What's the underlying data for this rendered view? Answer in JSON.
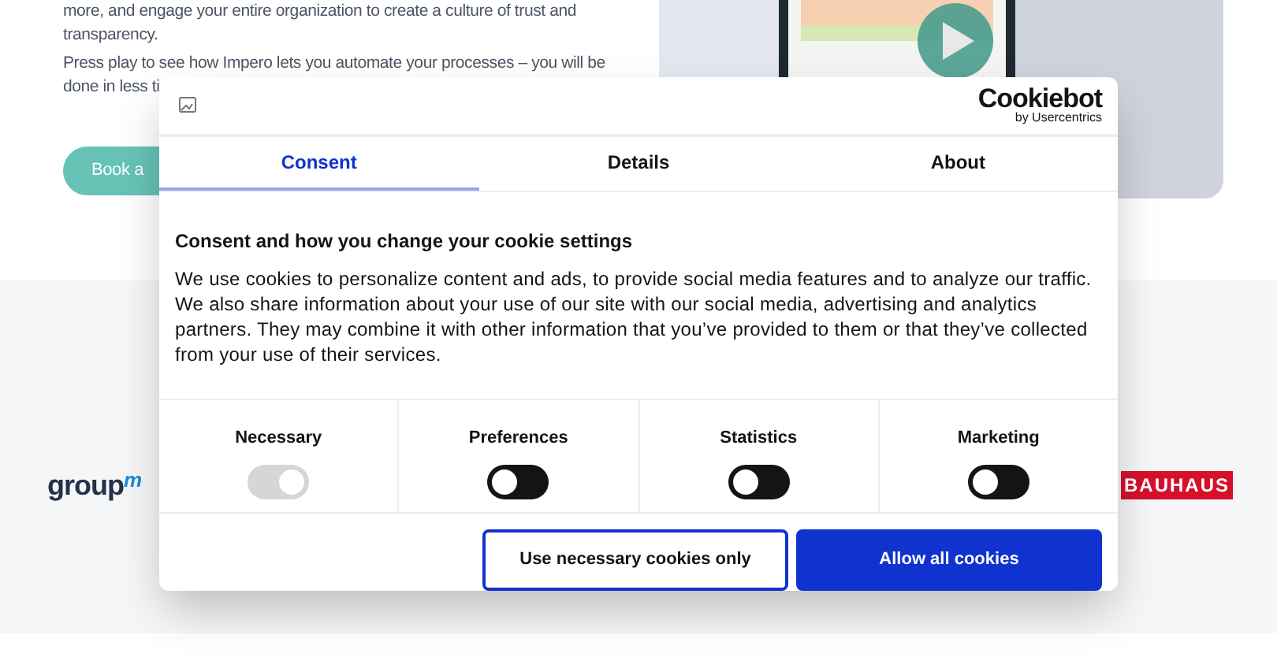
{
  "intro": {
    "paragraphs": [
      "more, and engage your entire organization to create a culture of trust and transparency.",
      "Press play to see how Impero lets you automate your processes – you will be",
      "done in less ti"
    ],
    "button": "Book a"
  },
  "logos": [
    {
      "text": "group",
      "mark": "m"
    },
    {
      "text": "BAUHAUS"
    }
  ],
  "dialog": {
    "brand": "Cookiebot",
    "brand_sub": "by Usercentrics",
    "tabs": [
      {
        "label": "Consent",
        "selected": true
      },
      {
        "label": "Details",
        "selected": false
      },
      {
        "label": "About",
        "selected": false
      }
    ],
    "heading": "Consent and how you change your cookie settings",
    "body": "We use cookies to personalize content and ads, to provide social media features and to analyze our traffic. We also share information about your use of our site with our social media, advertising and analytics partners. They may combine it with other information that you’ve provided to them or that they’ve collected from your use of their services.",
    "toggles": [
      {
        "label": "Necessary",
        "checked": true,
        "disabled": true
      },
      {
        "label": "Preferences",
        "checked": false,
        "disabled": false
      },
      {
        "label": "Statistics",
        "checked": false,
        "disabled": false
      },
      {
        "label": "Marketing",
        "checked": false,
        "disabled": false
      }
    ],
    "buttons": [
      {
        "label": "Use necessary cookies only",
        "kind": "outline"
      },
      {
        "label": "Allow all cookies",
        "kind": "filled"
      }
    ]
  }
}
